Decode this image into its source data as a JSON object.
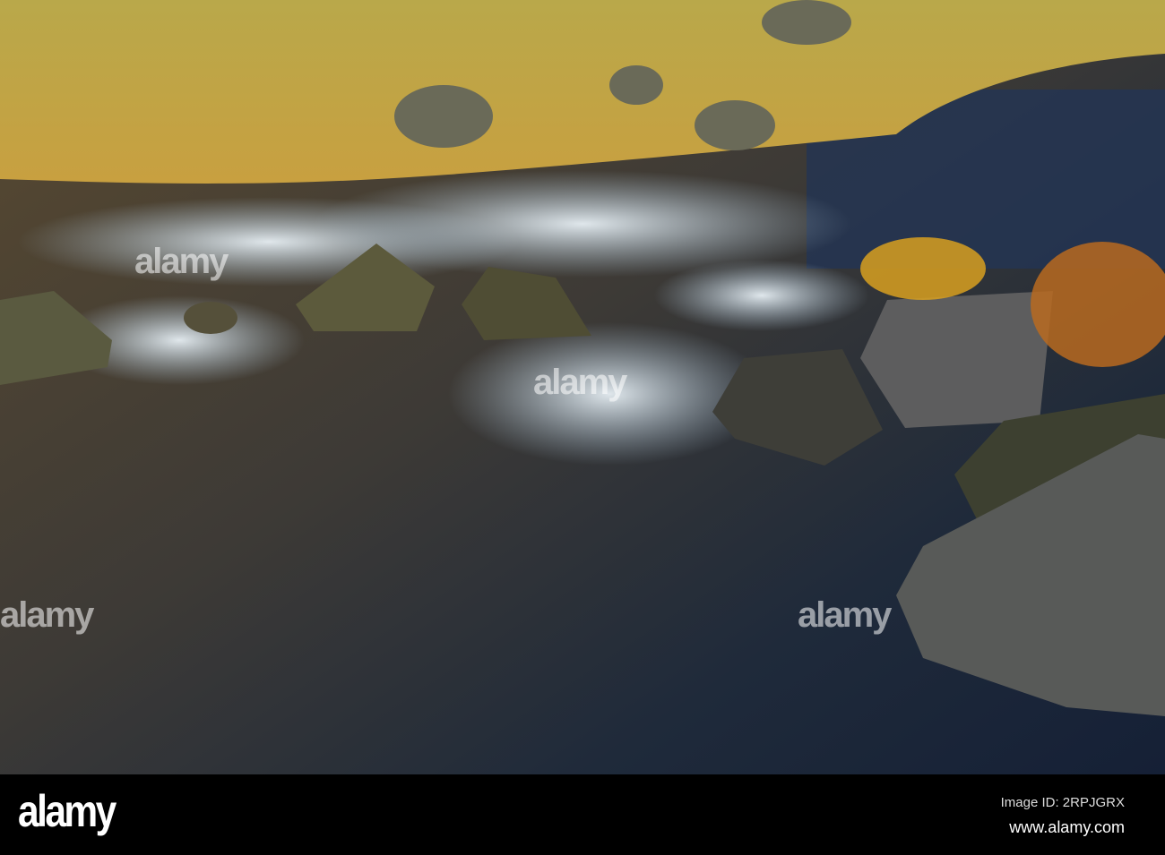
{
  "watermark": "alamy",
  "footer": {
    "logo": "alamy",
    "image_id": "Image ID: 2RPJGRX",
    "url": "www.alamy.com"
  }
}
